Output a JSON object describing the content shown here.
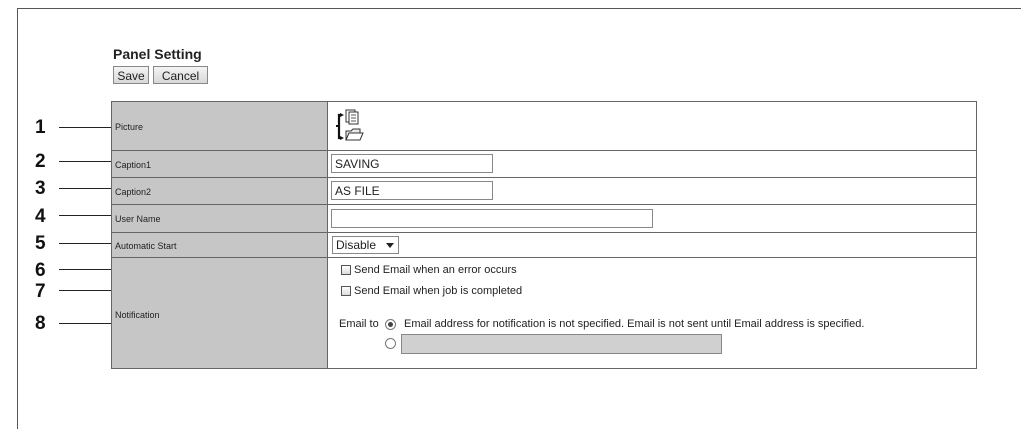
{
  "panel": {
    "title": "Panel Setting",
    "save_label": "Save",
    "cancel_label": "Cancel"
  },
  "callouts": [
    "1",
    "2",
    "3",
    "4",
    "5",
    "6",
    "7",
    "8"
  ],
  "rows": {
    "picture": {
      "label": "Picture"
    },
    "caption1": {
      "label": "Caption1",
      "value": "SAVING"
    },
    "caption2": {
      "label": "Caption2",
      "value": "AS FILE"
    },
    "user_name": {
      "label": "User Name",
      "value": ""
    },
    "automatic_start": {
      "label": "Automatic Start",
      "value": "Disable"
    },
    "notification": {
      "label": "Notification",
      "error_checkbox": {
        "label": "Send Email when an error occurs",
        "checked": false
      },
      "job_checkbox": {
        "label": "Send Email when job is completed",
        "checked": false
      },
      "email_to_label": "Email to",
      "radio_default_label": "Email address for notification is not specified. Email is not sent until Email address is specified.",
      "email_value": ""
    }
  }
}
